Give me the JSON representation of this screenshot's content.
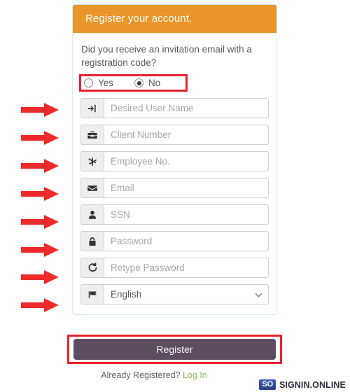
{
  "card": {
    "header_title": "Register your account.",
    "question": "Did you receive an invitation email with a registration code?",
    "invitation_radio": {
      "name": "invitation-code",
      "options": [
        {
          "label": "Yes",
          "value": "yes",
          "checked": false
        },
        {
          "label": "No",
          "value": "no",
          "checked": true
        }
      ]
    },
    "fields": [
      {
        "icon": "sign-in-icon",
        "name": "desired-user-name",
        "placeholder": "Desired User Name",
        "value": "",
        "type": "text"
      },
      {
        "icon": "briefcase-icon",
        "name": "client-number",
        "placeholder": "Client Number",
        "value": "",
        "type": "text"
      },
      {
        "icon": "asterisk-icon",
        "name": "employee-number",
        "placeholder": "Employee No.",
        "value": "",
        "type": "text"
      },
      {
        "icon": "envelope-icon",
        "name": "email",
        "placeholder": "Email",
        "value": "",
        "type": "text"
      },
      {
        "icon": "user-icon",
        "name": "ssn",
        "placeholder": "SSN",
        "value": "",
        "type": "text"
      },
      {
        "icon": "lock-icon",
        "name": "password",
        "placeholder": "Password",
        "value": "",
        "type": "password"
      },
      {
        "icon": "refresh-icon",
        "name": "retype-password",
        "placeholder": "Retype Password",
        "value": "",
        "type": "password"
      }
    ],
    "language_select": {
      "icon": "flag-icon",
      "name": "language",
      "selected": "English",
      "options": [
        "English"
      ]
    }
  },
  "register_button_label": "Register",
  "footer": {
    "already_text": "Already Registered?",
    "login_link": "Log In"
  },
  "brand": {
    "badge": "SO",
    "name": "SIGNIN.ONLINE"
  },
  "annotations": {
    "arrow_count": 8,
    "arrow_color": "#ee2a2a",
    "highlight_color": "#e8232a",
    "highlighted_regions": [
      "invitation-radio-row",
      "register-button"
    ]
  },
  "colors": {
    "header_orange": "#e8952a",
    "button_plum": "#5c4e60",
    "link_green": "#86c053",
    "card_border": "#d6e9f2",
    "addon_gray": "#eeeeee",
    "brand_blue": "#2b3f86"
  }
}
